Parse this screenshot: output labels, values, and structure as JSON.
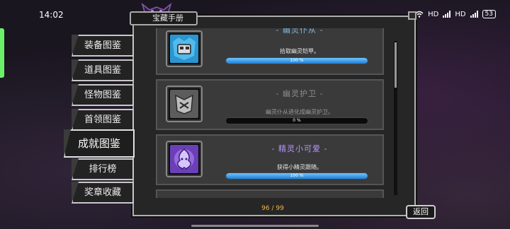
{
  "status_bar": {
    "time": "14:02",
    "battery": "53",
    "net1": "HD",
    "net2": "HD"
  },
  "panel": {
    "title": "宝藏手册",
    "counter": "96 / 99",
    "back_label": "返回"
  },
  "tabs": [
    {
      "label": "装备图鉴",
      "active": false
    },
    {
      "label": "道具图鉴",
      "active": false
    },
    {
      "label": "怪物图鉴",
      "active": false
    },
    {
      "label": "首领图鉴",
      "active": false
    },
    {
      "label": "成就图鉴",
      "active": true
    },
    {
      "label": "排行榜",
      "active": false
    },
    {
      "label": "奖章收藏",
      "active": false
    }
  ],
  "achievements": [
    {
      "name": "- 幽灵仆从 -",
      "desc": "拾取幽灵铠甲。",
      "progress_label": "100 %",
      "progress": 100,
      "icon": "ghost-armor-icon",
      "icon_color": "#41b8e8",
      "name_color": "#7fb6e0"
    },
    {
      "name": "- 幽灵护卫 -",
      "desc": "幽灵仆从进化成幽灵护卫。",
      "progress_label": "0 %",
      "progress": 0,
      "icon": "ghost-guard-icon",
      "icon_color": "#8f8f8f",
      "name_color": "#8d8d8d"
    },
    {
      "name": "- 精灵小可爱 -",
      "desc": "获得小精灵跟随。",
      "progress_label": "100 %",
      "progress": 100,
      "icon": "little-spirit-icon",
      "icon_color": "#9a6ee6",
      "name_color": "#b892ff"
    }
  ]
}
